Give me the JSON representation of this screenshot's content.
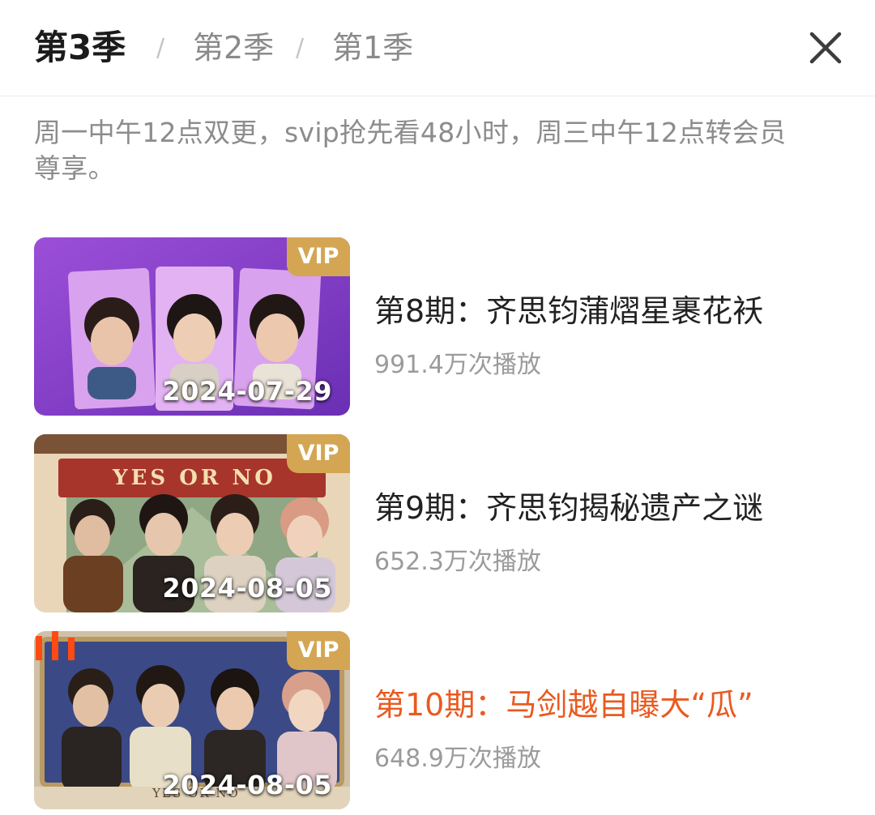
{
  "header": {
    "tabs": [
      {
        "label": "第3季",
        "active": true
      },
      {
        "label": "第2季",
        "active": false
      },
      {
        "label": "第1季",
        "active": false
      }
    ],
    "separator": "/",
    "close_icon": "close-icon"
  },
  "notice": "周一中午12点双更，svip抢先看48小时，周三中午12点转会员尊享。",
  "episodes": [
    {
      "title": "第8期：齐思钧蒲熠星裹花袄",
      "plays": "991.4万次播放",
      "date": "2024-07-29",
      "badge": "VIP",
      "current": false
    },
    {
      "title": "第9期：齐思钧揭秘遗产之谜",
      "plays": "652.3万次播放",
      "date": "2024-08-05",
      "badge": "VIP",
      "banner_text": "YES OR NO",
      "current": false
    },
    {
      "title": "第10期：马剑越自曝大“瓜”",
      "plays": "648.9万次播放",
      "date": "2024-08-05",
      "badge": "VIP",
      "banner_text": "YES OR NO",
      "current": true
    }
  ],
  "colors": {
    "vip_badge": "#d4a653",
    "current_title": "#ea5a1f",
    "active_tab": "#1b1b1b",
    "inactive_tab": "#8a8a8a"
  }
}
